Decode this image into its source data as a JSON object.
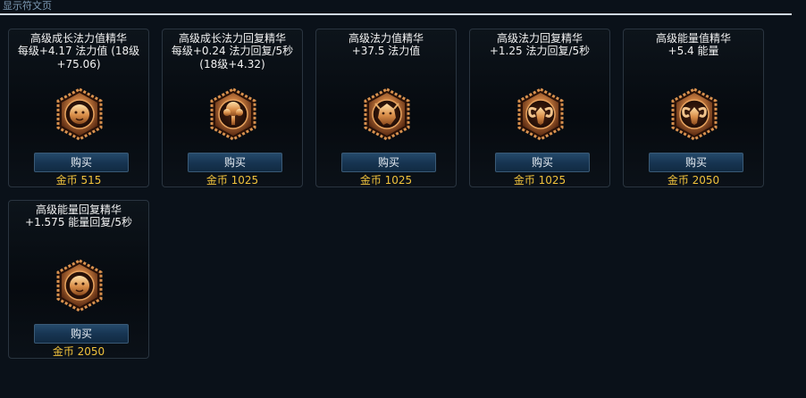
{
  "header": {
    "title": "显示符文页"
  },
  "cards": [
    {
      "name": "高级成长法力值精华",
      "desc": "每级+4.17 法力值 (18级+75.06)",
      "buy": "购买",
      "price": "金币 515",
      "icon": "lion-rune-icon"
    },
    {
      "name": "高级成长法力回复精华",
      "desc": "每级+0.24 法力回复/5秒 (18级+4.32)",
      "buy": "购买",
      "price": "金币 1025",
      "icon": "tree-rune-icon"
    },
    {
      "name": "高级法力值精华",
      "desc": "+37.5 法力值",
      "buy": "购买",
      "price": "金币 1025",
      "icon": "dragon-rune-icon"
    },
    {
      "name": "高级法力回复精华",
      "desc": "+1.25 法力回复/5秒",
      "buy": "购买",
      "price": "金币 1025",
      "icon": "ram-rune-icon"
    },
    {
      "name": "高级能量值精华",
      "desc": "+5.4 能量",
      "buy": "购买",
      "price": "金币 2050",
      "icon": "ram-rune-icon"
    },
    {
      "name": "高级能量回复精华",
      "desc": "+1.575 能量回复/5秒",
      "buy": "购买",
      "price": "金币 2050",
      "icon": "lion-rune-icon"
    }
  ],
  "colors": {
    "background": "#0a1119",
    "price": "#f0c23c",
    "button": "#173552",
    "rune_bronze": "#b8733a"
  }
}
